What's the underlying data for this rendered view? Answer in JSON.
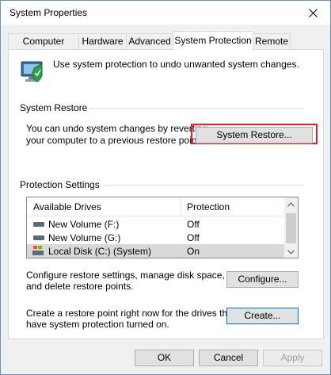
{
  "window": {
    "title": "System Properties"
  },
  "tabs": [
    {
      "label": "Computer Name"
    },
    {
      "label": "Hardware"
    },
    {
      "label": "Advanced"
    },
    {
      "label": "System Protection"
    },
    {
      "label": "Remote"
    }
  ],
  "intro_text": "Use system protection to undo unwanted system changes.",
  "system_restore": {
    "heading": "System Restore",
    "line1": "You can undo system changes by reverting",
    "line2": "your computer to a previous restore point.",
    "button": "System Restore..."
  },
  "protection": {
    "heading": "Protection Settings",
    "columns": [
      "Available Drives",
      "Protection"
    ],
    "drives": [
      {
        "name": "New Volume (F:)",
        "protection": "Off"
      },
      {
        "name": "New Volume (G:)",
        "protection": "Off"
      },
      {
        "name": "Local Disk (C:) (System)",
        "protection": "On"
      }
    ],
    "configure_text1": "Configure restore settings, manage disk space,",
    "configure_text2": "and delete restore points.",
    "configure_button": "Configure...",
    "create_text1": "Create a restore point right now for the drives that",
    "create_text2": "have system protection turned on.",
    "create_button": "Create..."
  },
  "footer": {
    "ok": "OK",
    "cancel": "Cancel",
    "apply": "Apply"
  },
  "colors": {
    "highlight_ring": "#e0232b",
    "focus_border": "#0078d7"
  }
}
